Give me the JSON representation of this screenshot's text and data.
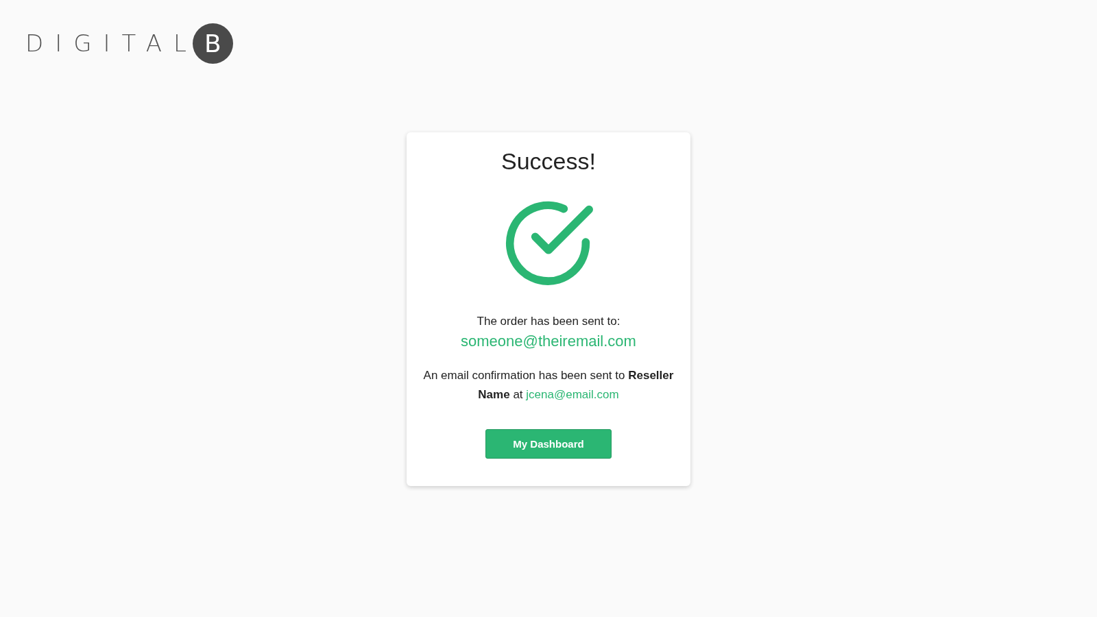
{
  "logo": {
    "text": "DIGITAL",
    "mark": "B"
  },
  "card": {
    "title": "Success!",
    "sent_label": "The order has been sent to:",
    "recipient_email": "someone@theiremail.com",
    "confirmation": {
      "text": "An email confirmation has been sent to **Reseller Name** at",
      "link": "jcena@email.com"
    },
    "button": "My Dashboard"
  }
}
